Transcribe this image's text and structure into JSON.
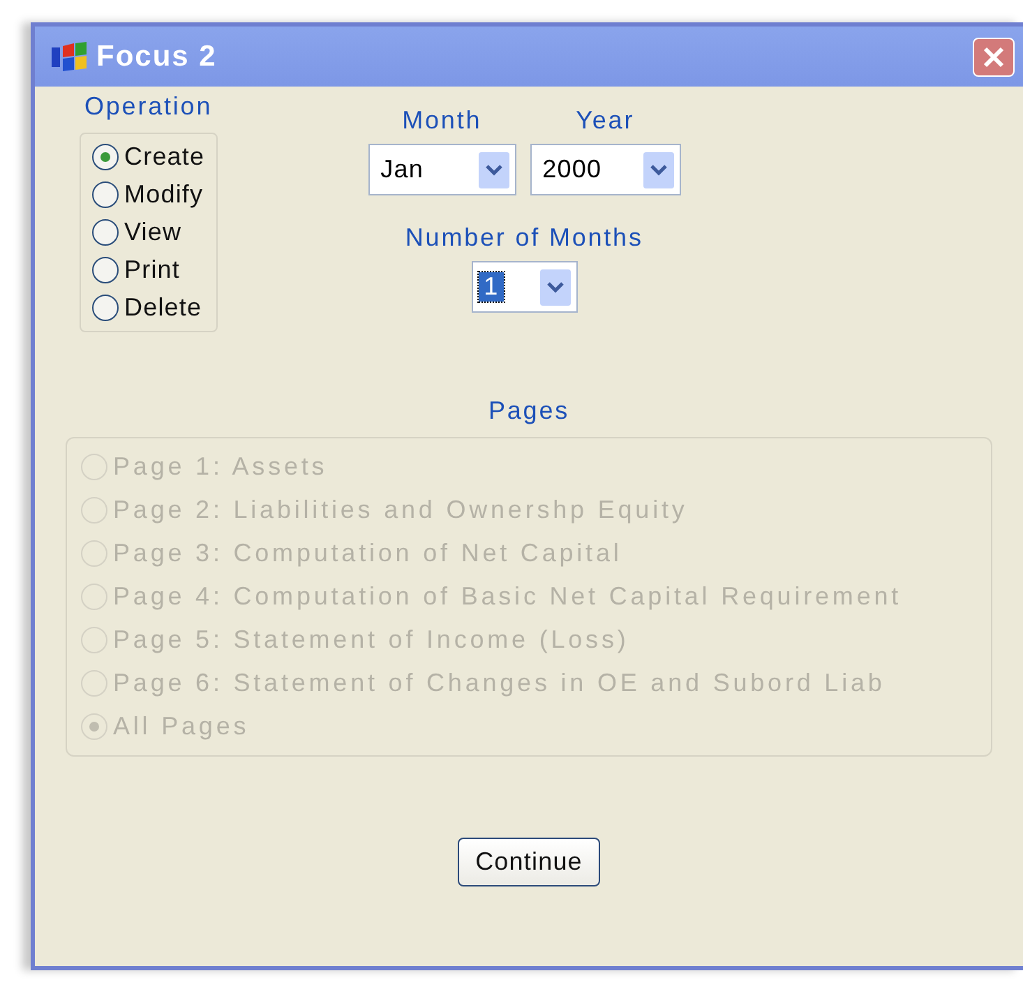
{
  "window": {
    "title": "Focus 2"
  },
  "operation": {
    "label": "Operation",
    "options": [
      {
        "label": "Create",
        "selected": true
      },
      {
        "label": "Modify",
        "selected": false
      },
      {
        "label": "View",
        "selected": false
      },
      {
        "label": "Print",
        "selected": false
      },
      {
        "label": "Delete",
        "selected": false
      }
    ]
  },
  "month": {
    "label": "Month",
    "value": "Jan"
  },
  "year": {
    "label": "Year",
    "value": "2000"
  },
  "number_of_months": {
    "label": "Number of Months",
    "value": "1"
  },
  "pages": {
    "label": "Pages",
    "disabled": true,
    "options": [
      {
        "label": "Page 1: Assets",
        "selected": false
      },
      {
        "label": "Page 2: Liabilities and Ownershp Equity",
        "selected": false
      },
      {
        "label": "Page 3: Computation of Net Capital",
        "selected": false
      },
      {
        "label": "Page 4: Computation of Basic Net Capital Requirement",
        "selected": false
      },
      {
        "label": "Page 5: Statement of Income (Loss)",
        "selected": false
      },
      {
        "label": "Page 6: Statement of Changes in OE and Subord Liab",
        "selected": false
      },
      {
        "label": "All Pages",
        "selected": true
      }
    ]
  },
  "continue_button": {
    "label": "Continue"
  }
}
